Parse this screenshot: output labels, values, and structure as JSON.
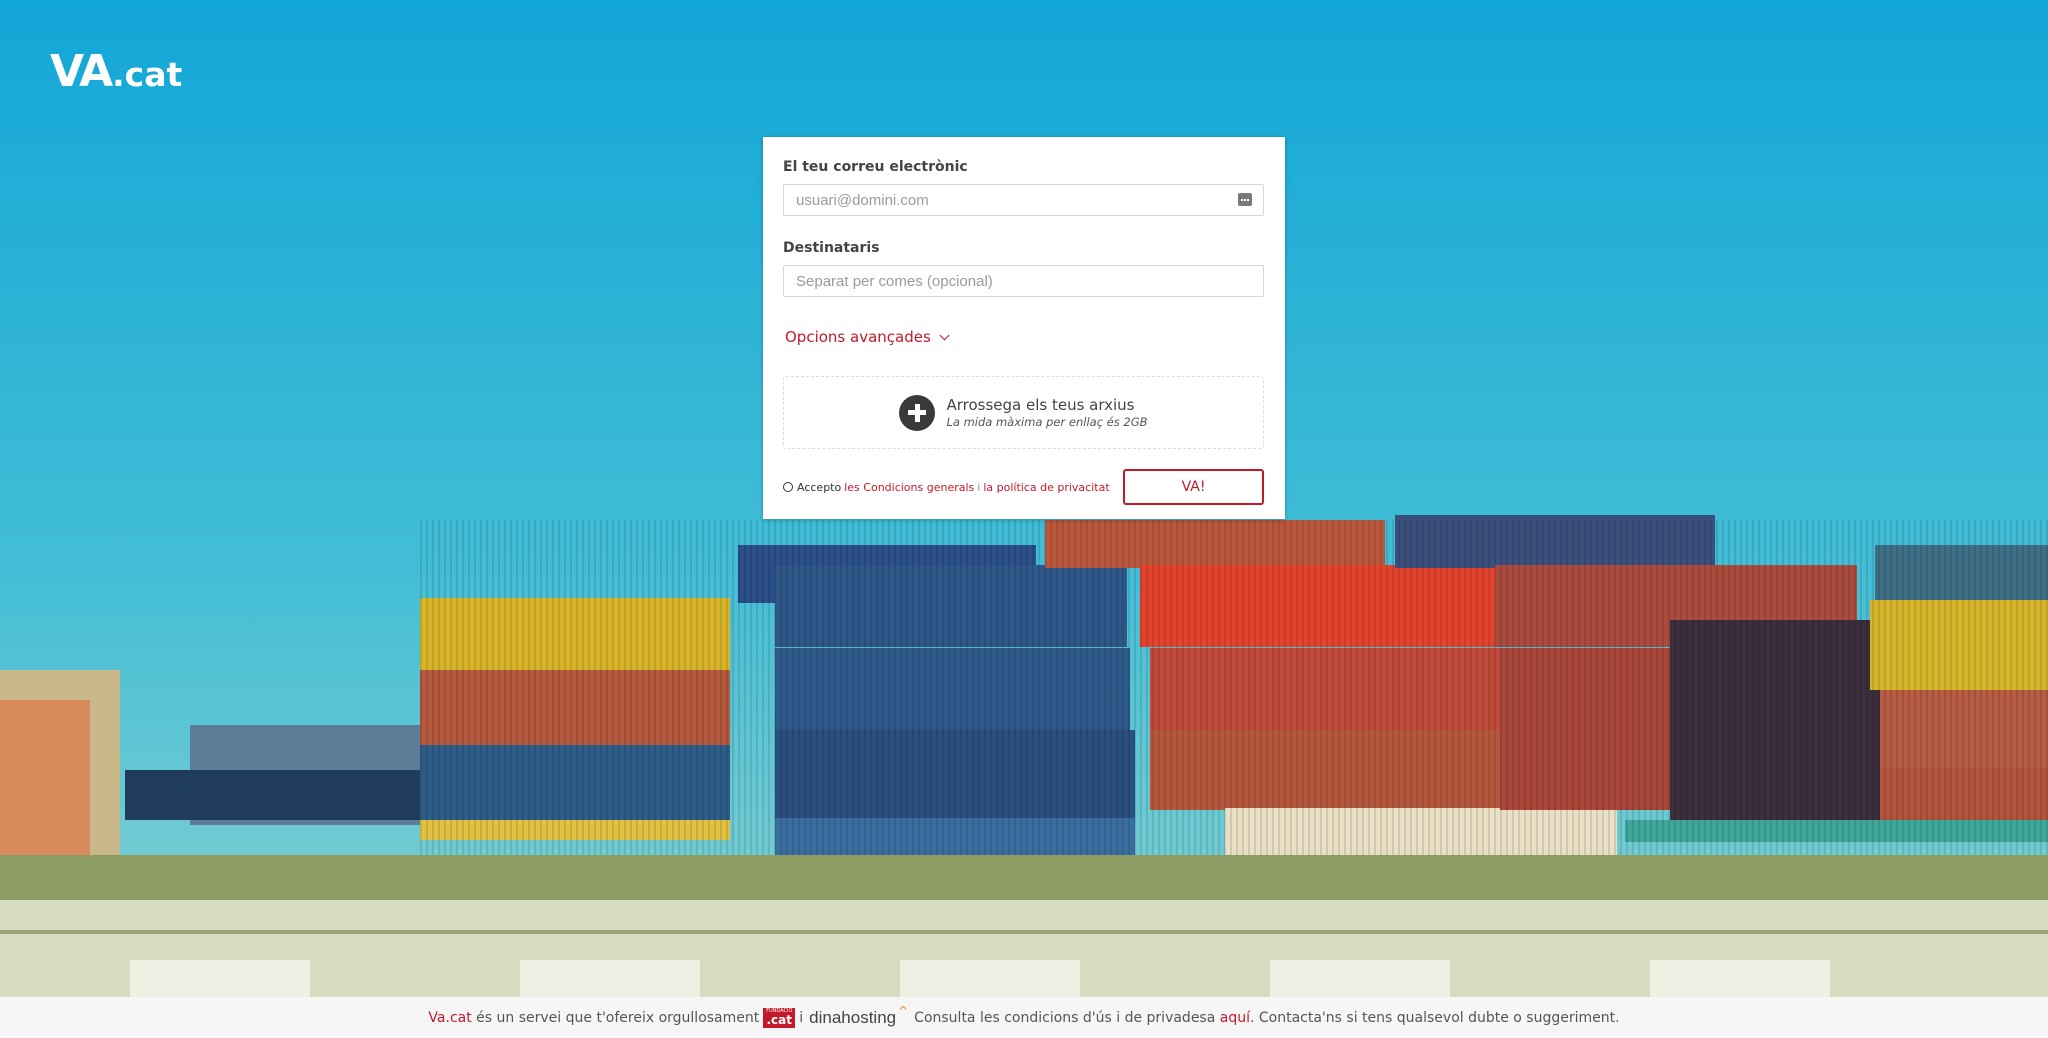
{
  "brand": {
    "logo_main": "VA",
    "logo_suffix": ".cat"
  },
  "form": {
    "email_label": "El teu correu electrònic",
    "email_placeholder": "usuari@domini.com",
    "recipients_label": "Destinataris",
    "recipients_placeholder": "Separat per comes (opcional)",
    "advanced_label": "Opcions avançades",
    "dropzone_title": "Arrossega els teus arxius",
    "dropzone_subtitle": "La mida màxima per enllaç és 2GB",
    "accept_prefix": "Accepto",
    "terms_link": "les Condicions generals",
    "separator": "i",
    "privacy_link": "la política de privacitat",
    "submit_label": "VA!"
  },
  "footer": {
    "brand_link": "Va.cat",
    "text_1": "és un servei que t'ofereix orgullosament",
    "badge_small": "FUNDACIÓ",
    "badge_big": ".cat",
    "text_2": "i",
    "partner_name": "dinahosting",
    "text_3": "Consulta les condicions d'ús i de privadesa",
    "here_link": "aquí",
    "text_4": ". Contacta'ns si tens qualsevol dubte o suggeriment."
  },
  "colors": {
    "accent": "#c21a2b",
    "sky": "#3fb7d6"
  },
  "icons": {
    "field_action": "keyboard-icon",
    "dropzone": "plus-circle-icon",
    "advanced": "chevron-down-icon",
    "partner": "dinahosting-caret-icon"
  }
}
